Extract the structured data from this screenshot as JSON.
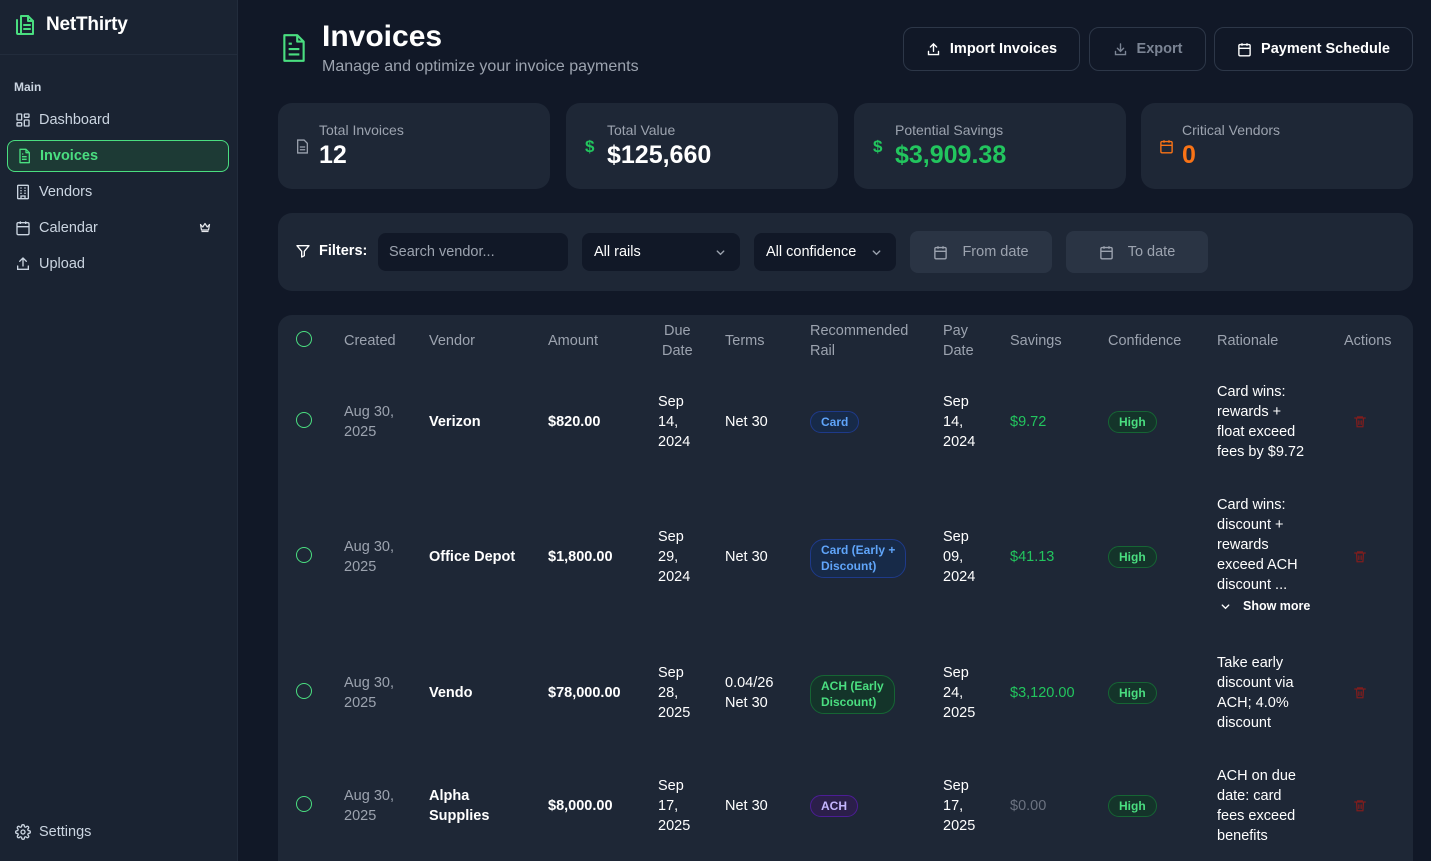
{
  "brand": {
    "name": "NetThirty",
    "icon": "ledger-icon"
  },
  "sidebar": {
    "section_label": "Main",
    "items": [
      {
        "label": "Dashboard",
        "icon": "dashboard-icon"
      },
      {
        "label": "Invoices",
        "icon": "file-text-icon",
        "active": true
      },
      {
        "label": "Vendors",
        "icon": "building-icon"
      },
      {
        "label": "Calendar",
        "icon": "calendar-icon",
        "badge_icon": "crown-icon"
      },
      {
        "label": "Upload",
        "icon": "upload-icon"
      }
    ],
    "settings_label": "Settings"
  },
  "header": {
    "title": "Invoices",
    "subtitle": "Manage and optimize your invoice payments",
    "buttons": {
      "import": "Import Invoices",
      "export": "Export",
      "schedule": "Payment Schedule"
    }
  },
  "stats": [
    {
      "label": "Total Invoices",
      "value": "12",
      "icon": "file-icon"
    },
    {
      "label": "Total Value",
      "value": "$125,660",
      "icon": "dollar-icon"
    },
    {
      "label": "Potential Savings",
      "value": "$3,909.38",
      "icon": "dollar-icon"
    },
    {
      "label": "Critical Vendors",
      "value": "0",
      "icon": "calendar-icon"
    }
  ],
  "filters": {
    "label": "Filters:",
    "search_placeholder": "Search vendor...",
    "rails_selected": "All rails",
    "confidence_selected": "All confidence",
    "from_date": "From date",
    "to_date": "To date"
  },
  "table": {
    "columns": {
      "created": "Created",
      "vendor": "Vendor",
      "amount": "Amount",
      "due_date_1": "Due",
      "due_date_2": "Date",
      "terms": "Terms",
      "rec_rail_1": "Recommended",
      "rec_rail_2": "Rail",
      "pay_date_1": "Pay",
      "pay_date_2": "Date",
      "savings": "Savings",
      "confidence": "Confidence",
      "rationale": "Rationale",
      "actions": "Actions"
    },
    "rows": [
      {
        "created": [
          "Aug 30,",
          "2025"
        ],
        "vendor": [
          "Verizon"
        ],
        "amount": "$820.00",
        "due": [
          "Sep",
          "14,",
          "2024"
        ],
        "terms": [
          "Net 30"
        ],
        "rail": [
          "Card"
        ],
        "pay": [
          "Sep",
          "14,",
          "2024"
        ],
        "savings": "$9.72",
        "confidence": "High",
        "rationale": [
          "Card wins:",
          "rewards +",
          "float exceed",
          "fees by $9.72"
        ]
      },
      {
        "created": [
          "Aug 30,",
          "2025"
        ],
        "vendor": [
          "Office Depot"
        ],
        "amount": "$1,800.00",
        "due": [
          "Sep",
          "29,",
          "2024"
        ],
        "terms": [
          "Net 30"
        ],
        "rail": [
          "Card (Early +",
          "Discount)"
        ],
        "pay": [
          "Sep",
          "09,",
          "2024"
        ],
        "savings": "$41.13",
        "confidence": "High",
        "rationale": [
          "Card wins:",
          "discount +",
          "rewards",
          "exceed ACH",
          "discount ..."
        ],
        "show_more": "Show more"
      },
      {
        "created": [
          "Aug 30,",
          "2025"
        ],
        "vendor": [
          "Vendo"
        ],
        "amount": "$78,000.00",
        "due": [
          "Sep",
          "28,",
          "2025"
        ],
        "terms": [
          "0.04/26",
          "Net 30"
        ],
        "rail": [
          "ACH (Early",
          "Discount)"
        ],
        "pay": [
          "Sep",
          "24,",
          "2025"
        ],
        "savings": "$3,120.00",
        "confidence": "High",
        "rationale": [
          "Take early",
          "discount via",
          "ACH; 4.0%",
          "discount"
        ]
      },
      {
        "created": [
          "Aug 30,",
          "2025"
        ],
        "vendor": [
          "Alpha",
          "Supplies"
        ],
        "amount": "$8,000.00",
        "due": [
          "Sep",
          "17,",
          "2025"
        ],
        "terms": [
          "Net 30"
        ],
        "rail": [
          "ACH"
        ],
        "pay": [
          "Sep",
          "17,",
          "2025"
        ],
        "savings": "$0.00",
        "confidence": "High",
        "rationale": [
          "ACH on due",
          "date: card",
          "fees exceed",
          "benefits"
        ]
      }
    ]
  },
  "colors": {
    "accent_green": "#4ade80",
    "savings_green": "#22c55e",
    "critical_orange": "#f97316",
    "trash_red": "#7f1d1d",
    "background": "#111827",
    "card": "#1e2736"
  }
}
